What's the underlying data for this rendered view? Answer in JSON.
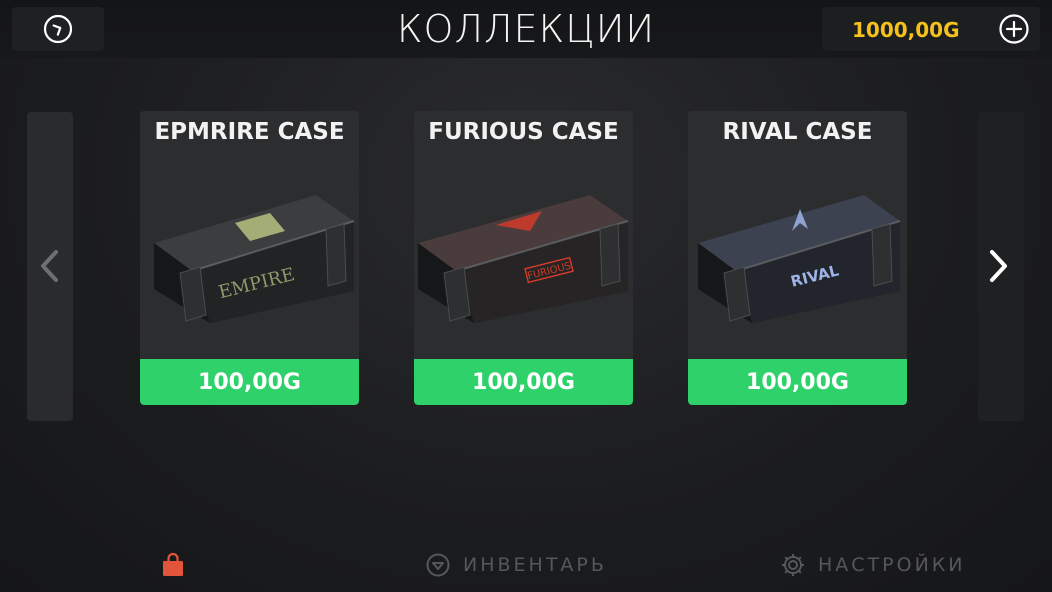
{
  "header": {
    "title": "КОЛЛЕКЦИИ",
    "balance": "1000,00G",
    "back_icon": "back-circle-icon",
    "add_icon": "plus-circle-icon"
  },
  "cases": [
    {
      "name": "EPMRIRE CASE",
      "price": "100,00G",
      "art_label": "EMPIRE",
      "accent": "#c8d38a"
    },
    {
      "name": "FURIOUS CASE",
      "price": "100,00G",
      "art_label": "FURIOUS",
      "accent": "#d23a2a"
    },
    {
      "name": "RIVAL CASE",
      "price": "100,00G",
      "art_label": "RIVAL",
      "accent": "#9fb4e6"
    }
  ],
  "nav": {
    "shop_icon": "shopping-bag-icon",
    "inventory": "ИНВЕНТАРЬ",
    "settings": "НАСТРОЙКИ"
  },
  "colors": {
    "price_bg": "#2fd16a",
    "balance": "#f4c21c",
    "shop_active": "#e2553a"
  }
}
